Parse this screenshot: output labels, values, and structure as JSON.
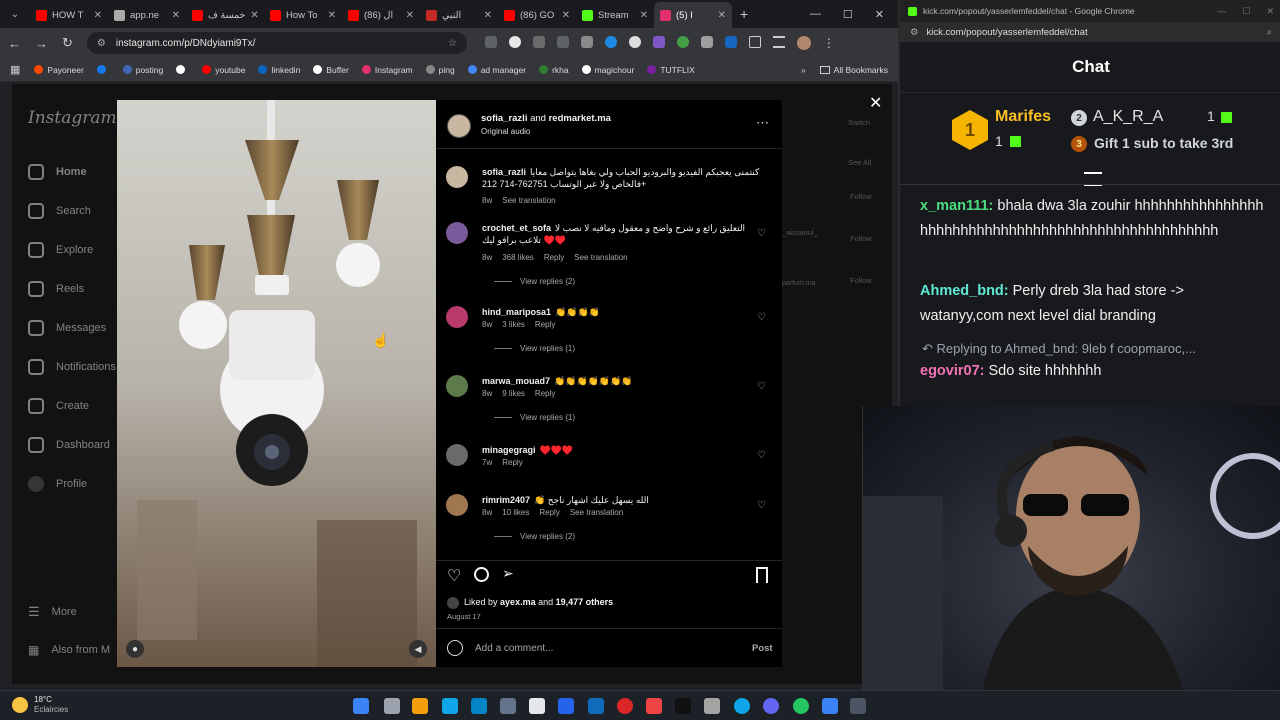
{
  "tabs": [
    {
      "label": "HOW T",
      "color": "#ff0000"
    },
    {
      "label": "app.ne",
      "color": "#aaaaaa"
    },
    {
      "label": "خمسة ف",
      "color": "#ff0000"
    },
    {
      "label": "How To",
      "color": "#ff0000"
    },
    {
      "label": "(86) ال",
      "color": "#ff0000"
    },
    {
      "label": "النبي",
      "color": "#c62828"
    },
    {
      "label": "(86) GO",
      "color": "#ff0000"
    },
    {
      "label": "Stream",
      "color": "#53fc18"
    },
    {
      "label": "(5) I",
      "color": "#e1306c"
    }
  ],
  "url": "instagram.com/p/DNdyiami9Tx/",
  "bookmarks": [
    {
      "label": "Payoneer",
      "color": "#ff4800"
    },
    {
      "label": "",
      "color": "#1877f2"
    },
    {
      "label": "posting",
      "color": "#4267b2"
    },
    {
      "label": "",
      "color": "#ffffff"
    },
    {
      "label": "youtube",
      "color": "#ff0000"
    },
    {
      "label": "linkedin",
      "color": "#0a66c2"
    },
    {
      "label": "Buffer",
      "color": "#ffffff"
    },
    {
      "label": "Instagram",
      "color": "#e1306c"
    },
    {
      "label": "ping",
      "color": "#888888"
    },
    {
      "label": "ad manager",
      "color": "#4285f4"
    },
    {
      "label": "rkha",
      "color": "#2e7d32"
    },
    {
      "label": "magichour",
      "color": "#ffffff"
    },
    {
      "label": "TUTFLIX",
      "color": "#7b1fa2"
    }
  ],
  "all_bookmarks": "All Bookmarks",
  "ig_logo": "Instagram",
  "ig_nav": [
    "Home",
    "Search",
    "Explore",
    "Reels",
    "Messages",
    "Notifications",
    "Create",
    "Dashboard",
    "Profile"
  ],
  "ig_more": "More",
  "ig_also": "Also from M",
  "post": {
    "author_line_user": "sofia_razli",
    "author_line_and": "and",
    "author_line_user2": "redmarket.ma",
    "audio": "Original audio",
    "caption_user": "sofia_razli",
    "caption": "كنتمنى يعجبكم الفيديو والبروديو الحباب ولي بغاها يتواصل معايا فالخاص ولا عبر الوتساب 762751-714 212+",
    "caption_time": "8w",
    "caption_translate": "See translation",
    "comments": [
      {
        "user": "crochet_et_sofa",
        "text": "التعليق رائع و شرح واضح و معقول ومافيه لا نصب لا تلاعب برافو ليك ♥️♥️",
        "time": "8w",
        "likes": "368 likes",
        "reply": "Reply",
        "translate": "See translation",
        "replies": "View replies (2)",
        "avatar": "#7b5a9b"
      },
      {
        "user": "hind_mariposa1",
        "text": "👏👏👏👏",
        "time": "8w",
        "likes": "3 likes",
        "reply": "Reply",
        "translate": "",
        "replies": "View replies (1)",
        "avatar": "#b83a6a"
      },
      {
        "user": "marwa_mouad7",
        "text": "👏👏👏👏👏👏👏",
        "time": "8w",
        "likes": "9 likes",
        "reply": "Reply",
        "translate": "",
        "replies": "View replies (1)",
        "avatar": "#5d7a4a"
      },
      {
        "user": "minagegragi",
        "text": "♥️♥️♥️",
        "time": "7w",
        "likes": "",
        "reply": "Reply",
        "translate": "",
        "replies": "",
        "avatar": "#6a6a6a"
      },
      {
        "user": "rimrim2407",
        "text": "👏 الله يسهل عليك اشهار ناجح",
        "time": "8w",
        "likes": "10 likes",
        "reply": "Reply",
        "translate": "See translation",
        "replies": "View replies (2)",
        "avatar": "#a07850"
      }
    ],
    "liked_by_prefix": "Liked by",
    "liked_by_user": "ayex.ma",
    "liked_by_and": "and",
    "liked_by_count": "19,477 others",
    "date": "August 17",
    "add_comment_placeholder": "Add a comment...",
    "post_button": "Post"
  },
  "ig_bg_side": {
    "switch": "Switch",
    "see_all": "See All",
    "follow": "Follow",
    "aissaoui": "_aissaoui_",
    "parfum": "parfum.ma"
  },
  "kick": {
    "title": "kick.com/popout/yasserlemfeddel/chat - Google Chrome",
    "url": "kick.com/popout/yasserlemfeddel/chat",
    "header": "Chat",
    "top1_name": "Marifes",
    "top1_count": "1",
    "top2_rank": "2",
    "top2_name": "A_K_R_A",
    "top2_count": "1",
    "third_rank": "3",
    "third_text": "Gift 1 sub to take 3rd",
    "messages": [
      {
        "name": "x_man111:",
        "color": "#4ade80",
        "text": "bhala dwa 3la zouhir hhhhhhhhhhhhhhhhhhhhhhhhhhhhhhhhhhhhhhhhhhhhhhhhhhhhh"
      },
      {
        "name": "Ahmed_bnd:",
        "color": "#5eead4",
        "text": "Perly dreb 3la had store -> watanyy,com next level dial branding"
      }
    ],
    "reply_ref": "Replying to Ahmed_bnd: 9leb f coopmaroc,...",
    "reply_name": "egovir07:",
    "reply_color": "#f472b6",
    "reply_text": "Sdo site hhhhhhh"
  },
  "weather": {
    "temp": "18°C",
    "desc": "Eclaircies"
  }
}
